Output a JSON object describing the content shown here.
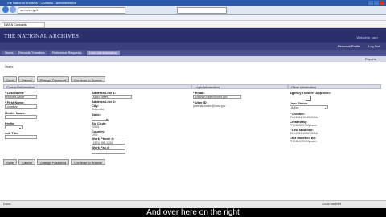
{
  "browser": {
    "title": "The National Archives - Contacts - Administration",
    "url": "archives.gov",
    "tab_label": "NARA Contacts"
  },
  "site": {
    "logo": "THE NATIONAL ARCHIVES",
    "logged_in": "Welcome, user",
    "links": [
      "Personal Profile",
      "Log Out"
    ]
  },
  "nav": {
    "tabs": [
      "Home",
      "Records Transfers",
      "Reference Requests",
      "User Administration"
    ]
  },
  "subnav": {
    "reports": "Reports"
  },
  "page": {
    "section_label": "Users"
  },
  "buttons": [
    "Save",
    "Cancel",
    "Change Password",
    "Continue to Browse"
  ],
  "contact": {
    "header": "Contact Information",
    "last_name_label": "* Last Name:",
    "last_name_value": "Richard-Bader",
    "first_name_label": "* First Name:",
    "first_name_value": "Jonathan",
    "middle_label": "Middle Name:",
    "prefix_label": "Prefix:",
    "job_title_label": "Job Title:",
    "addr1_label": "Address Line 1:",
    "addr1_value": "Main Street",
    "addr2_label": "Address Line 2:",
    "city_label": "City:",
    "city_value": "Columbia",
    "state_label": "State:",
    "zip_label": "Zip Code:",
    "zip_value": "20001",
    "country_label": "Country:",
    "country_value": "USA",
    "phone_label": "Work Phone #:",
    "phone_value": "(301) 555-1234",
    "fax_label": "Work Fax #:"
  },
  "login": {
    "header": "Login Information",
    "email_label": "* Email:",
    "email_value": "jonathan.bader@nara.gov",
    "userid_label": "* User ID:",
    "userid_value": "jonathan.bader@nara.gov"
  },
  "other": {
    "header": "Other Information",
    "approver_label": "Agency Transfer Approver:",
    "status_label": "User Status:",
    "status_value": "Active",
    "created_label": "* Created:",
    "created_value": "3/18/2011 10:45:00 AM",
    "created_by_label": "Created By:",
    "created_by_value": "PRODUCTION\\jbader",
    "modified_label": "* Last Modified:",
    "modified_value": "3/18/2011 11:52:46 AM",
    "modified_by_label": "Last Modified By:",
    "modified_by_value": "PRODUCTION\\jbader"
  },
  "statusbar": {
    "left": "Done",
    "right": "Local intranet"
  },
  "caption": "And over here on the right"
}
